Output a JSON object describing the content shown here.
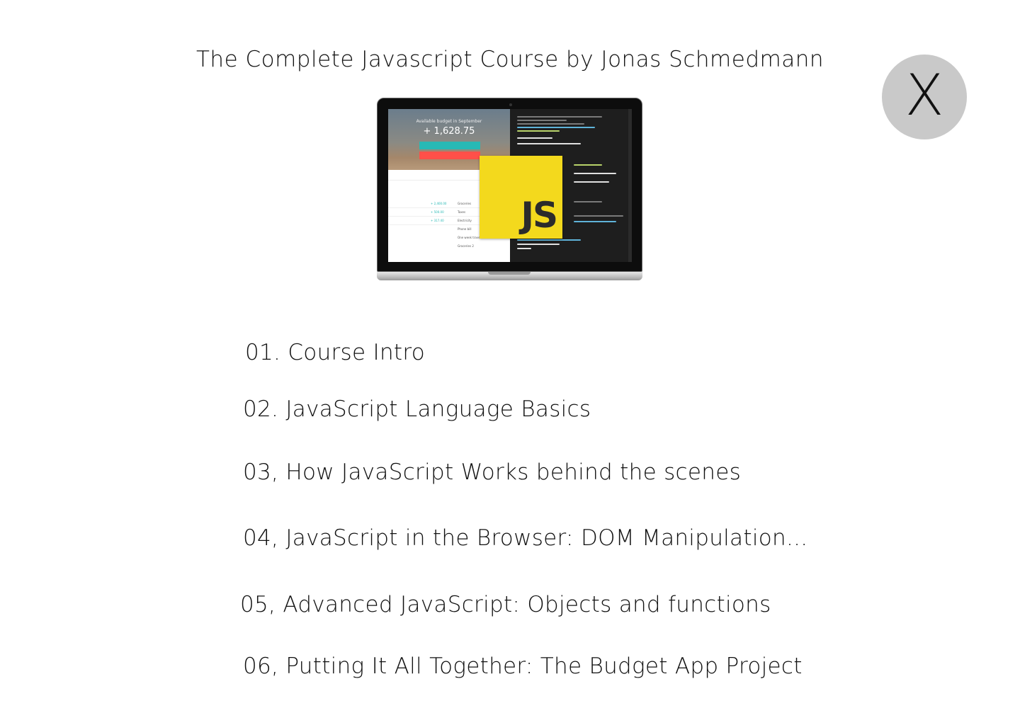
{
  "header": {
    "title": "The Complete Javascript Course by Jonas Schmedmann",
    "close_label": "X"
  },
  "course_image": {
    "badge_text": "JS",
    "app_title": "Available budget in September",
    "app_value": "+ 1,628.75",
    "income_rows": [
      "+ 2,400.00",
      "+ 500.00",
      "+ 317.40"
    ],
    "expense_labels": [
      "Groceries",
      "Taxes",
      "Electricity",
      "Phone bill",
      "One week travel",
      "Groceries 2"
    ]
  },
  "lessons": [
    {
      "label": "01. Course Intro"
    },
    {
      "label": "02. JavaScript Language Basics"
    },
    {
      "label": "03, How JavaScript Works behind the scenes"
    },
    {
      "label": "04, JavaScript in the Browser: DOM Manipulation..."
    },
    {
      "label": "05, Advanced JavaScript: Objects and functions"
    },
    {
      "label": "06, Putting It All Together: The Budget App Project"
    }
  ],
  "colors": {
    "close_button_bg": "#c9c9c9",
    "js_badge": "#f3d91d",
    "income": "#28b9b5",
    "expense": "#ff5049"
  }
}
